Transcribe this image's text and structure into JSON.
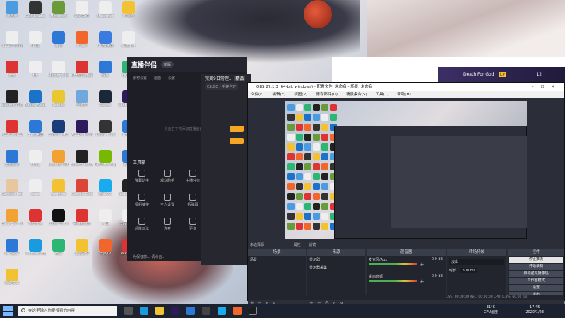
{
  "desktop_icons": [
    {
      "label": "此电脑",
      "color": "#4b9be0"
    },
    {
      "label": "OBS Studio",
      "color": "#333"
    },
    {
      "label": "Minecraft",
      "color": "#6a9a3a"
    },
    {
      "label": "新建文件",
      "color": "#eee"
    },
    {
      "label": "Minecraft",
      "color": "#eee"
    },
    {
      "label": "PT桌面",
      "color": "#f2c233"
    },
    {
      "label": "Super Bunny Man",
      "color": "#eee"
    },
    {
      "label": "dftg",
      "color": "#eee"
    },
    {
      "label": "设置",
      "color": "#2b78d6"
    },
    {
      "label": "Origin",
      "color": "#f2662b"
    },
    {
      "label": "UU加速器",
      "color": "#3a7be0"
    },
    {
      "label": "新建文件",
      "color": "#eee"
    },
    {
      "label": "nds",
      "color": "#d33"
    },
    {
      "label": "ttt",
      "color": "#eee"
    },
    {
      "label": "Marner's Avenger",
      "color": "#eee"
    },
    {
      "label": "CFHD电竞版 持大佬",
      "color": "#d33"
    },
    {
      "label": "网易",
      "color": "#2b78d6"
    },
    {
      "label": "QQ音乐",
      "color": "#2bb673"
    },
    {
      "label": "steam客户端",
      "color": "#222"
    },
    {
      "label": "Adobe Acrobat",
      "color": "#1a72c9"
    },
    {
      "label": "Roblox",
      "color": "#e8c730"
    },
    {
      "label": "回收站",
      "color": "#6fa8dc"
    },
    {
      "label": "Steam",
      "color": "#1b2838"
    },
    {
      "label": "Adobe After Effects",
      "color": "#2c1a5c"
    },
    {
      "label": "Roblox Studio",
      "color": "#d33"
    },
    {
      "label": "SS加速器",
      "color": "#2b78d6"
    },
    {
      "label": "Cinema 4D",
      "color": "#1a3d7a"
    },
    {
      "label": "Adobe Premiere",
      "color": "#2c1a5c"
    },
    {
      "label": "Steam Cloud",
      "color": "#333"
    },
    {
      "label": "BT面板",
      "color": "#2b78d6"
    },
    {
      "label": "迅雷影音",
      "color": "#2b78d6"
    },
    {
      "label": "ctcty",
      "color": "#eee"
    },
    {
      "label": "Counter-Strike Global Off...",
      "color": "#f2a233"
    },
    {
      "label": "Steam Render",
      "color": "#222"
    },
    {
      "label": "GeForce Experience",
      "color": "#76b900"
    },
    {
      "label": "鲁大师",
      "color": "#2b78d6"
    },
    {
      "label": "Genshin Impact",
      "color": "#e8c7a0"
    },
    {
      "label": "csgo",
      "color": "#eee"
    },
    {
      "label": "wegame",
      "color": "#f2c233"
    },
    {
      "label": "Google Chrome",
      "color": "#db4437"
    },
    {
      "label": "腾讯QQ",
      "color": "#1aabee"
    },
    {
      "label": "FeelSmart Motion",
      "color": "#222"
    },
    {
      "label": "Easy Cat Timer",
      "color": "#f2a233"
    },
    {
      "label": "WPS文字",
      "color": "#d33"
    },
    {
      "label": "Logitech G HUB",
      "color": "#111"
    },
    {
      "label": "网易云音乐",
      "color": "#d33"
    },
    {
      "label": "只因",
      "color": "#eee"
    },
    {
      "label": "EverSync",
      "color": "#eee"
    },
    {
      "label": "WPS文字",
      "color": "#2b78d6"
    },
    {
      "label": "Microsoft Edge",
      "color": "#1a9be0"
    },
    {
      "label": "微信",
      "color": "#2bb673"
    },
    {
      "label": "重要文件",
      "color": "#f2c233"
    },
    {
      "label": "芒果TV",
      "color": "#f2662b"
    },
    {
      "label": "WPS表格",
      "color": "#d33"
    },
    {
      "label": "新建文本",
      "color": "#f2c233"
    }
  ],
  "live_app": {
    "logo": "直播伴侣",
    "version": "新版",
    "tabs": [
      "素材设置",
      "画面",
      "设置"
    ],
    "empty_hint": "点击右下方添加直播画面开始",
    "tools_title": "工具箱",
    "tools": [
      "弹幕助手",
      "观众助手",
      "主播任务",
      "福利抽奖",
      "主人设置",
      "拆弹器",
      "超能玩法",
      "连麦",
      "更多"
    ],
    "bottom_notice": "为保证您... 请点击..."
  },
  "stream_panel": {
    "title": "完美9日常理...",
    "title_tag": "精品",
    "game": "CS:GO - 手搓自定"
  },
  "danmu": {
    "username": "Death For God",
    "level": "Lv",
    "count": "12"
  },
  "obs": {
    "title": "OBS 27.1.3 (64-bit, windows) - 配置文件: 未命名 - 场景: 未命名",
    "menu": [
      "文件(F)",
      "编辑(E)",
      "视图(V)",
      "停靠部件(D)",
      "场景集合(S)",
      "工具(T)",
      "帮助(H)"
    ],
    "source_label": "未选择源",
    "properties_label": "属性",
    "filters_label": "滤镜",
    "docks": {
      "scenes": {
        "title": "场景",
        "items": [
          "场景"
        ]
      },
      "sources": {
        "title": "来源",
        "items": [
          "显示器",
          "显示器采集"
        ]
      },
      "mixer": {
        "title": "混音器",
        "rows": [
          {
            "name": "麦克风/Aux",
            "value": "0.0 dB"
          },
          {
            "name": "桌面音频",
            "value": "0.0 dB"
          }
        ]
      },
      "transitions": {
        "title": "转场特效",
        "type": "淡出",
        "duration_label": "时长",
        "duration": "300 ms"
      },
      "controls": {
        "title": "控件",
        "buttons": [
          "停止推流",
          "开始录制",
          "启动虚拟摄像机",
          "工作室模式",
          "设置",
          "退出"
        ]
      }
    },
    "status": "LIVE: 00:00:00   REC: 00:00:00   CPU: 0.4%, 60.00 fps"
  },
  "taskbar": {
    "search_placeholder": "在这里输入你要搜索的内容",
    "temp": "31°C",
    "temp_label": "CPU温度",
    "time": "17:45",
    "date": "2022/1/23"
  }
}
